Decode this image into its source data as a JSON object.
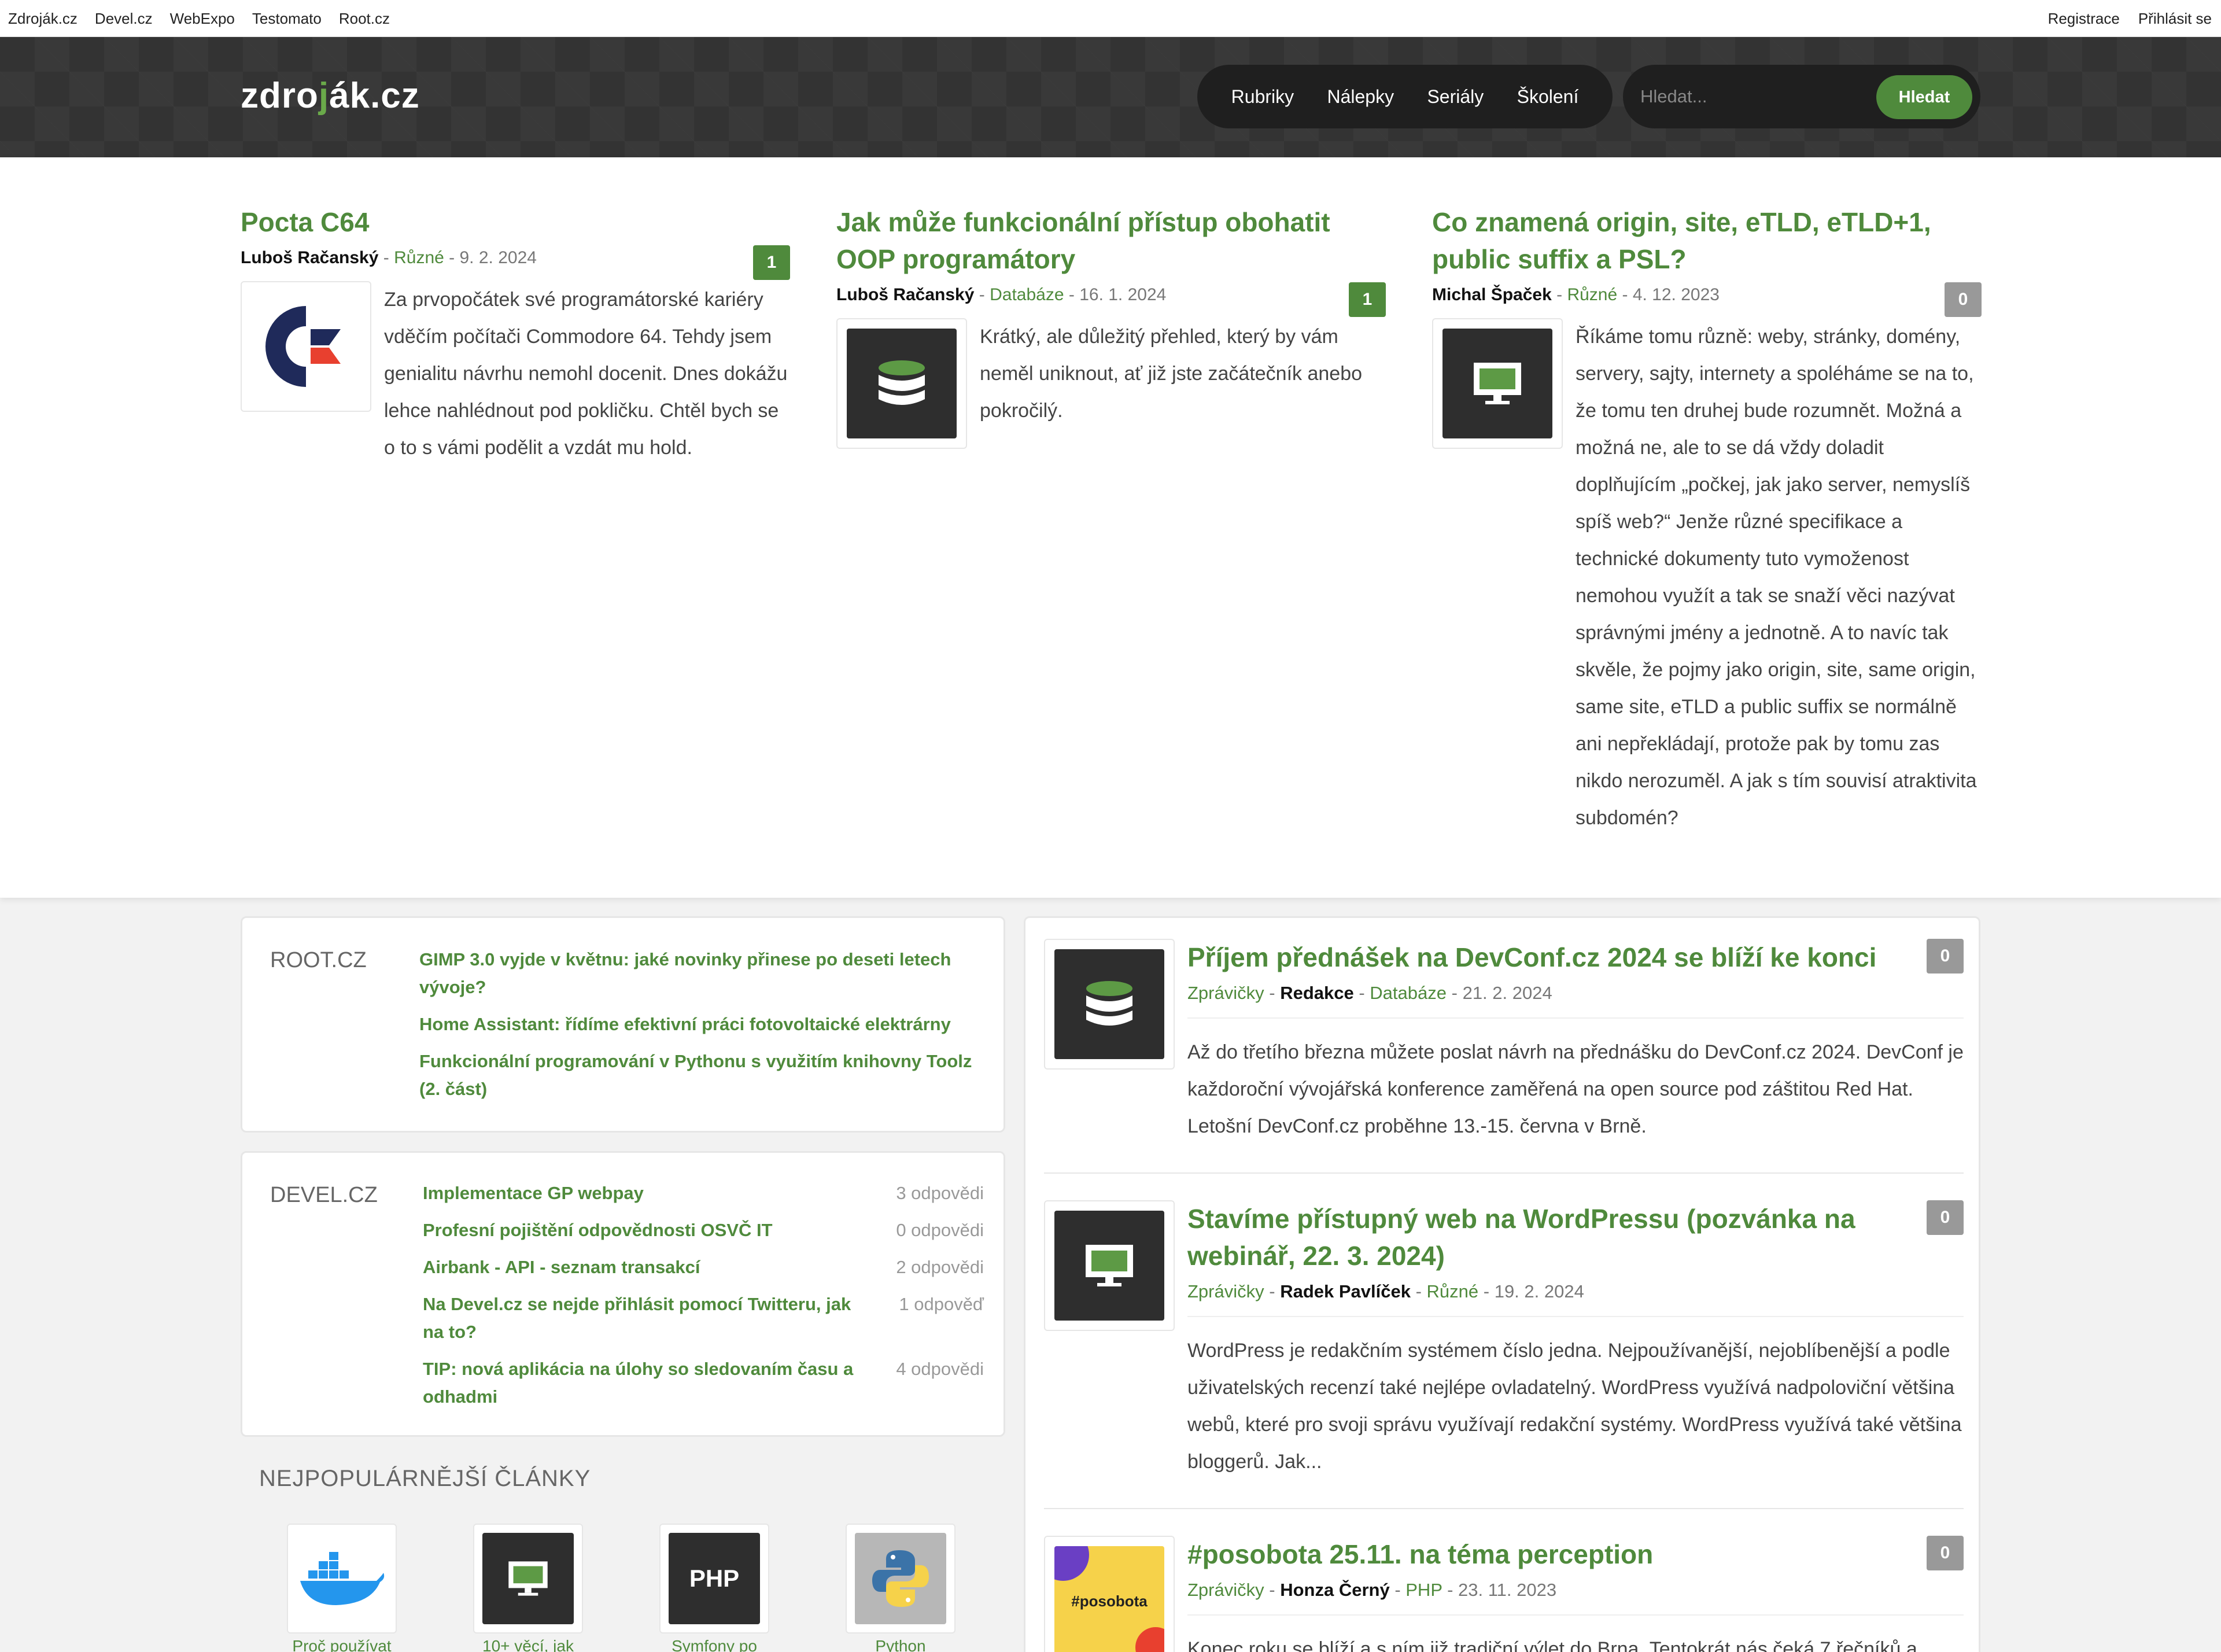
{
  "topbar": {
    "links": [
      "Zdroják.cz",
      "Devel.cz",
      "WebExpo",
      "Testomato",
      "Root.cz"
    ],
    "register": "Registrace",
    "login": "Přihlásit se"
  },
  "header": {
    "logo_left": "zdro",
    "logo_j": "j",
    "logo_right": "ák.cz",
    "nav": [
      "Rubriky",
      "Nálepky",
      "Seriály",
      "Školení"
    ],
    "search_placeholder": "Hledat...",
    "search_button": "Hledat"
  },
  "featured": [
    {
      "title": "Pocta C64",
      "author": "Luboš Račanský",
      "category": "Různé",
      "date": "9. 2. 2024",
      "comments": "1",
      "icon": "commodore-logo-icon",
      "text": "Za prvopočátek své programátorské kariéry vděčím počítači Commodore 64. Tehdy jsem genialitu návrhu nemohl docenit. Dnes dokážu lehce nahlédnout pod pokličku. Chtěl bych se o to s vámi podělit a vzdát mu hold."
    },
    {
      "title": "Jak může funkcionální přístup obohatit OOP programátory",
      "author": "Luboš Račanský",
      "category": "Databáze",
      "date": "16. 1. 2024",
      "comments": "1",
      "icon": "database-icon",
      "text": "Krátký, ale důležitý přehled, který by vám neměl uniknout, ať již jste začátečník anebo pokročilý."
    },
    {
      "title": "Co znamená origin, site, eTLD, eTLD+1, public suffix a PSL?",
      "author": "Michal Špaček",
      "category": "Různé",
      "date": "4. 12. 2023",
      "comments": "0",
      "icon": "monitor-icon",
      "text": "Říkáme tomu různě: weby, stránky, domény, servery, sajty, internety a spoléháme se na to, že tomu ten druhej bude rozumnět. Možná a možná ne, ale to se dá vždy doladit doplňujícím „počkej, jak jako server, nemyslíš spíš web?“ Jenže různé specifikace a technické dokumenty tuto vymoženost nemohou využít a tak se snaží věci nazývat správnými jmény a jednotně. A to navíc tak skvěle, že pojmy jako origin, site, same origin, same site, eTLD a public suffix se normálně ani nepřekládají, protože pak by tomu zas nikdo nerozuměl. A jak s tím souvisí atraktivita subdomén?"
    }
  ],
  "root": {
    "label": "ROOT.CZ",
    "items": [
      "GIMP 3.0 vyjde v květnu: jaké novinky přinese po deseti letech vývoje?",
      "Home Assistant: řídíme efektivní práci fotovoltaické elektrárny",
      "Funkcionální programování v Pythonu s využitím knihovny Toolz (2. část)"
    ]
  },
  "devel": {
    "label": "DEVEL.CZ",
    "items": [
      {
        "title": "Implementace GP webpay",
        "count": "3 odpovědi"
      },
      {
        "title": "Profesní pojištění odpovědnosti OSVČ IT",
        "count": "0 odpovědi"
      },
      {
        "title": "Airbank - API - seznam transakcí",
        "count": "2 odpovědi"
      },
      {
        "title": "Na Devel.cz se nejde přihlásit pomocí Twitteru, jak na to?",
        "count": "1 odpověď"
      },
      {
        "title": "TIP: nová aplikácia na úlohy so sledovaním času a odhadmi",
        "count": "4 odpovědi"
      }
    ]
  },
  "popular": {
    "title": "NEJPOPULÁRNĚJŠÍ ČLÁNKY",
    "items": [
      {
        "caption": "Proč používat",
        "icon": "docker-icon"
      },
      {
        "caption": "10+ věcí, jak AI",
        "icon": "monitor-icon"
      },
      {
        "caption": "Symfony po",
        "icon": "php-icon"
      },
      {
        "caption": "Python",
        "icon": "python-icon"
      }
    ]
  },
  "articles": [
    {
      "title": "Příjem přednášek na DevConf.cz 2024 se blíží ke konci",
      "type": "Zprávičky",
      "author": "Redakce",
      "category": "Databáze",
      "date": "21. 2. 2024",
      "comments": "0",
      "icon": "database-icon",
      "text": "Až do třetího března můžete poslat návrh na přednášku do DevConf.cz 2024. DevConf je každoroční vývojářská konference zaměřená na open source pod záštitou Red Hat. Letošní DevConf.cz proběhne 13.-15. června v Brně."
    },
    {
      "title": "Stavíme přístupný web na WordPressu (pozvánka na webinář, 22. 3. 2024)",
      "type": "Zprávičky",
      "author": "Radek Pavlíček",
      "category": "Různé",
      "date": "19. 2. 2024",
      "comments": "0",
      "icon": "monitor-icon",
      "text": "WordPress je redakčním systémem číslo jedna. Nejpoužívanější, nejoblíbenější a podle uživatelských recenzí také nejlépe ovladatelný. WordPress využívá nadpoloviční většina webů, které pro svoji správu využívají redakční systémy. WordPress využívá také většina bloggerů. Jak..."
    },
    {
      "title": "#posobota 25.11. na téma perception",
      "type": "Zprávičky",
      "author": "Honza Černý",
      "category": "PHP",
      "date": "23. 11. 2023",
      "comments": "0",
      "icon": "posobota-logo-icon",
      "thumb_text": "#posobota",
      "text": "Konec roku se blíží a s ním již tradiční výlet do Brna. Tentokrát nás čeká 7 řečníků a..."
    }
  ]
}
